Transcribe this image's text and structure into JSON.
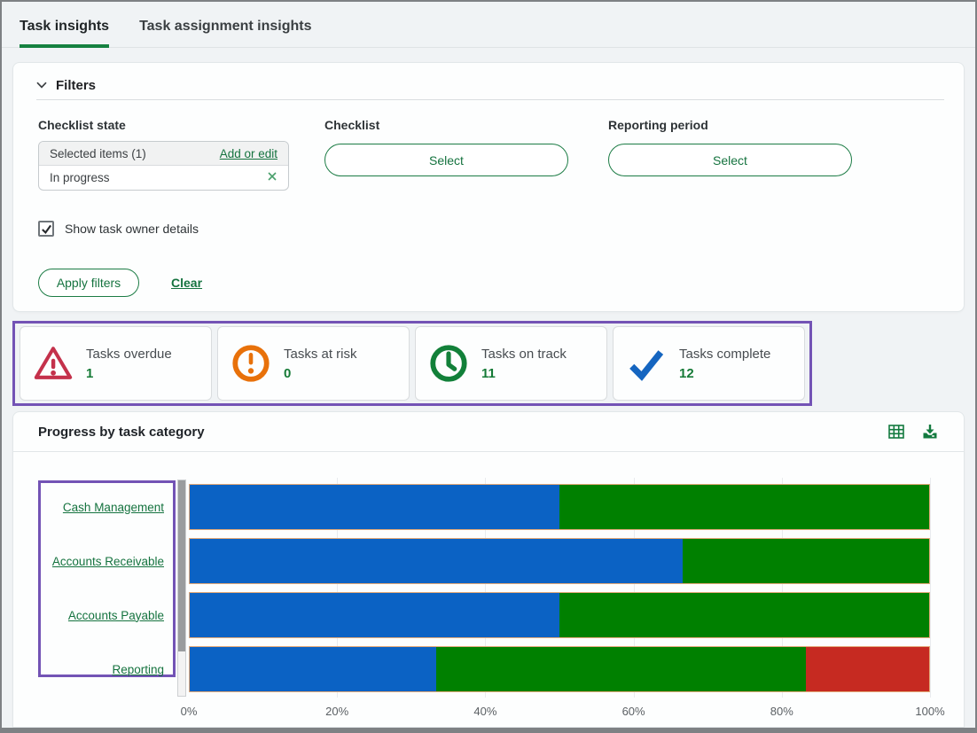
{
  "tabs": [
    {
      "label": "Task insights",
      "active": true
    },
    {
      "label": "Task assignment insights",
      "active": false
    }
  ],
  "filters": {
    "title": "Filters",
    "checklist_state": {
      "label": "Checklist state",
      "selected_items_text": "Selected items (1)",
      "add_or_edit_label": "Add or edit",
      "selected_value": "In progress"
    },
    "checklist": {
      "label": "Checklist",
      "select_label": "Select"
    },
    "reporting_period": {
      "label": "Reporting period",
      "select_label": "Select"
    },
    "show_task_owner_details": {
      "label": "Show task owner details",
      "checked": "true"
    },
    "apply_label": "Apply filters",
    "clear_label": "Clear"
  },
  "summary": {
    "cards": [
      {
        "label": "Tasks overdue",
        "value": "1",
        "icon": "warning-triangle-icon",
        "icon_color": "#c4314b"
      },
      {
        "label": "Tasks at risk",
        "value": "0",
        "icon": "exclamation-circle-icon",
        "icon_color": "#e8710a"
      },
      {
        "label": "Tasks on track",
        "value": "11",
        "icon": "clock-icon",
        "icon_color": "#128039"
      },
      {
        "label": "Tasks complete",
        "value": "12",
        "icon": "checkmark-icon",
        "icon_color": "#1565c0"
      }
    ]
  },
  "chart_section": {
    "title": "Progress by task category",
    "toolbar_icons": [
      "table-view-icon",
      "download-icon"
    ]
  },
  "chart_data": {
    "type": "bar",
    "orientation": "horizontal",
    "stacked": true,
    "title": "Progress by task category",
    "categories": [
      "Cash Management",
      "Accounts Receivable",
      "Accounts Payable",
      "Reporting"
    ],
    "series": [
      {
        "name": "Tasks complete",
        "color": "#0b62c4",
        "values_pct": [
          50.0,
          66.7,
          50.0,
          33.3
        ]
      },
      {
        "name": "Tasks on track",
        "color": "#008000",
        "values_pct": [
          50.0,
          33.3,
          50.0,
          50.0
        ]
      },
      {
        "name": "Tasks overdue",
        "color": "#c62a21",
        "values_pct": [
          0,
          0,
          0,
          16.7
        ]
      }
    ],
    "x_ticks": [
      "0%",
      "20%",
      "40%",
      "60%",
      "80%",
      "100%"
    ],
    "xlim": [
      0,
      100
    ],
    "grid": "vertical",
    "legend": "none"
  },
  "annotation": {
    "highlight_color": "#7353b5"
  }
}
